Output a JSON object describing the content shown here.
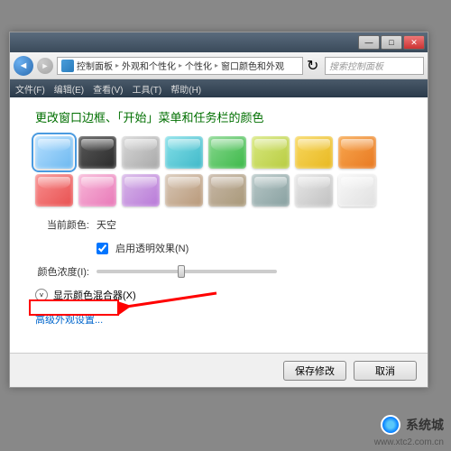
{
  "window": {
    "minimize": "—",
    "maximize": "□",
    "close": "✕"
  },
  "nav": {
    "back": "◄",
    "forward": "►",
    "refresh": "↻"
  },
  "breadcrumb": {
    "sep": "▸",
    "items": [
      "控制面板",
      "外观和个性化",
      "个性化",
      "窗口颜色和外观"
    ]
  },
  "search": {
    "placeholder": "搜索控制面板"
  },
  "menu": {
    "file": "文件(F)",
    "edit": "编辑(E)",
    "view": "查看(V)",
    "tools": "工具(T)",
    "help": "帮助(H)"
  },
  "content": {
    "title": "更改窗口边框、「开始」菜单和任务栏的颜色",
    "current_label": "当前颜色:",
    "current_value": "天空",
    "transparency_label": "启用透明效果(N)",
    "intensity_label": "颜色浓度(I):",
    "mixer_label": "显示颜色混合器(X)",
    "advanced_link": "高级外观设置..."
  },
  "swatches": [
    {
      "c1": "#b8e0ff",
      "c2": "#6bb8f0",
      "selected": true
    },
    {
      "c1": "#5a5a5a",
      "c2": "#2a2a2a"
    },
    {
      "c1": "#d8d8d8",
      "c2": "#a8a8a8"
    },
    {
      "c1": "#86e0e9",
      "c2": "#3eb8c8"
    },
    {
      "c1": "#88d88f",
      "c2": "#3cb848"
    },
    {
      "c1": "#d8e880",
      "c2": "#b8cc40"
    },
    {
      "c1": "#f8d860",
      "c2": "#e8b820"
    },
    {
      "c1": "#f8a850",
      "c2": "#e87820"
    },
    {
      "c1": "#f89090",
      "c2": "#e85050"
    },
    {
      "c1": "#f8b8d8",
      "c2": "#e878b8"
    },
    {
      "c1": "#d8b8e8",
      "c2": "#b878d8"
    },
    {
      "c1": "#d8c8b8",
      "c2": "#b89878"
    },
    {
      "c1": "#c8b8a8",
      "c2": "#a89878"
    },
    {
      "c1": "#b8c8c8",
      "c2": "#88a0a0"
    },
    {
      "c1": "#e8e8e8",
      "c2": "#c0c0c0"
    },
    {
      "c1": "#f8f8f8",
      "c2": "#e0e0e0"
    }
  ],
  "footer": {
    "save": "保存修改",
    "cancel": "取消"
  },
  "watermark": {
    "text": "系统城",
    "url": "www.xtc2.com.cn"
  }
}
